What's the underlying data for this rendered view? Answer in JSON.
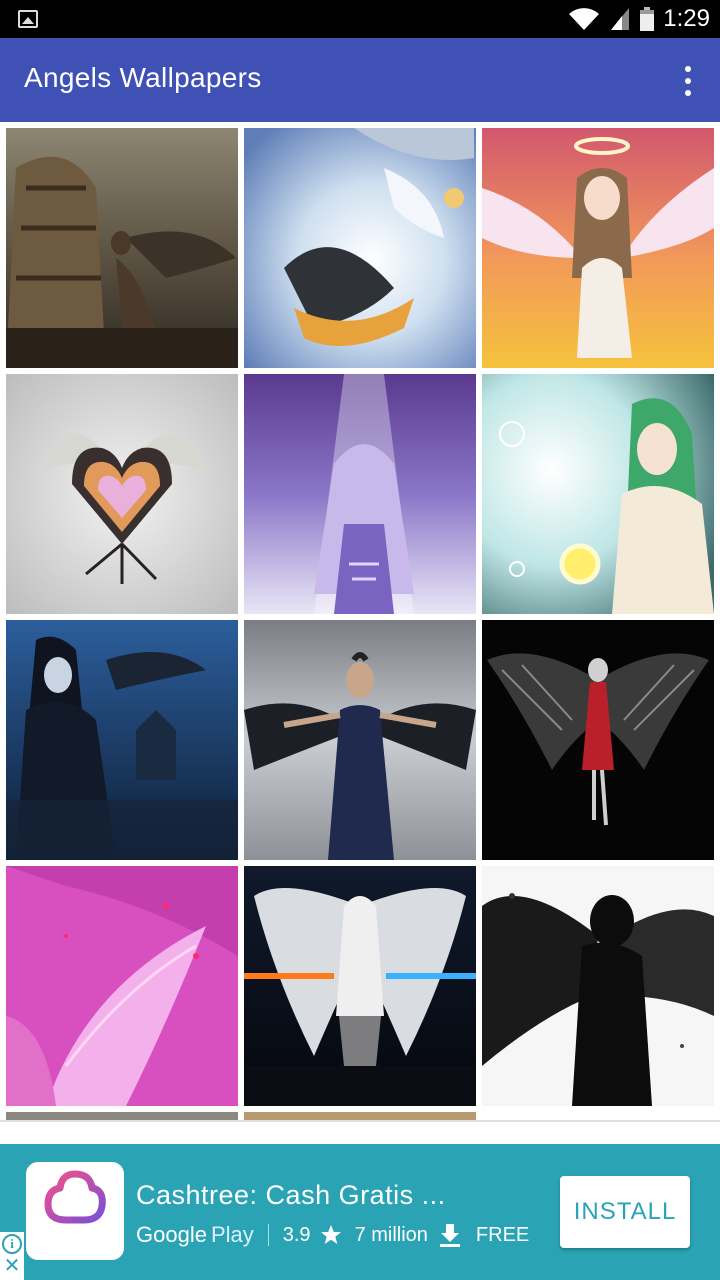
{
  "status_bar": {
    "time": "1:29",
    "icons": [
      "image-icon",
      "wifi-icon",
      "signal-icon",
      "battery-icon"
    ]
  },
  "app_bar": {
    "title": "Angels Wallpapers",
    "menu_icon": "more-vert-icon"
  },
  "grid": {
    "columns": 3,
    "wallpapers": [
      {
        "subject": "winged man chained to wooden horse"
      },
      {
        "subject": "anime angels with white and dark wings"
      },
      {
        "subject": "anime angel girl with halo"
      },
      {
        "subject": "winged heart emblem"
      },
      {
        "subject": "anime angel girl in violet light"
      },
      {
        "subject": "green-haired anime angel with glowing orb"
      },
      {
        "subject": "dark-haired angel in blue night"
      },
      {
        "subject": "woman with black wings in blue dress"
      },
      {
        "subject": "dark angel with red ribbon"
      },
      {
        "subject": "pink angel wings"
      },
      {
        "subject": "fire and ice winged angel"
      },
      {
        "subject": "black winged silhouette"
      }
    ]
  },
  "ad": {
    "app_name": "Cashtree: Cash Gratis ...",
    "store_google": "Google",
    "store_play": "Play",
    "rating": "3.9",
    "downloads": "7 million",
    "price": "FREE",
    "install_label": "INSTALL",
    "colors": {
      "background": "#2aa3b5",
      "icon_gradient_start": "#f4508b",
      "icon_gradient_end": "#7a4fd6"
    }
  },
  "colors": {
    "app_bar": "#3f51b5",
    "status_bar": "#000000"
  }
}
